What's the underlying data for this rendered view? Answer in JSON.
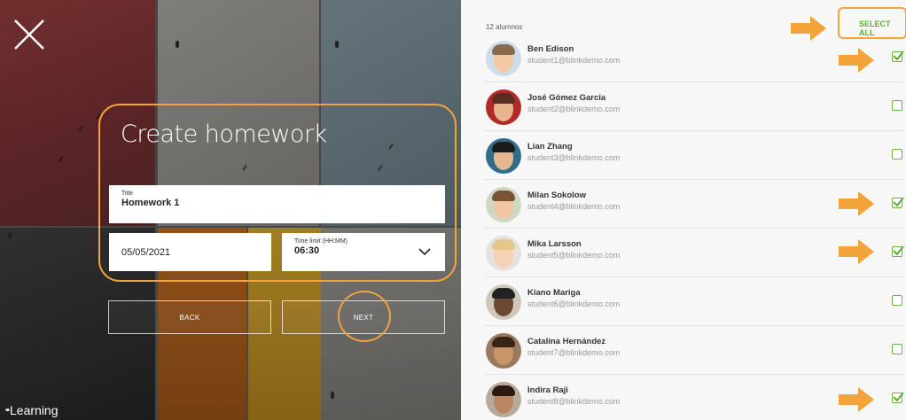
{
  "dialog": {
    "title": "Create homework",
    "title_field": {
      "label": "Title",
      "value": "Homework 1"
    },
    "date_field": {
      "value": "05/05/2021"
    },
    "time_field": {
      "label": "Time limit (HH:MM)",
      "value": "06:30"
    },
    "back_label": "BACK",
    "next_label": "NEXT"
  },
  "brand": {
    "dots": "••",
    "name": "Learning"
  },
  "students": {
    "count_label": "12 alumnos",
    "select_all_label": "SELECT ALL",
    "list": [
      {
        "name": "Ben Edison",
        "email": "student1@blinkdemo.com",
        "checked": true
      },
      {
        "name": "José Gómez García",
        "email": "student2@blinkdemo.com",
        "checked": false
      },
      {
        "name": "Lian Zhang",
        "email": "student3@blinkdemo.com",
        "checked": false
      },
      {
        "name": "Milan Sokolow",
        "email": "student4@blinkdemo.com",
        "checked": true
      },
      {
        "name": "Mika Larsson",
        "email": "student5@blinkdemo.com",
        "checked": true
      },
      {
        "name": "Kiano Mariga",
        "email": "student6@blinkdemo.com",
        "checked": false
      },
      {
        "name": "Catalina Hernández",
        "email": "student7@blinkdemo.com",
        "checked": false
      },
      {
        "name": "Indira Raji",
        "email": "student8@blinkdemo.com",
        "checked": true
      }
    ]
  },
  "colors": {
    "highlight": "#f2a33a",
    "check_green": "#5fae32"
  }
}
